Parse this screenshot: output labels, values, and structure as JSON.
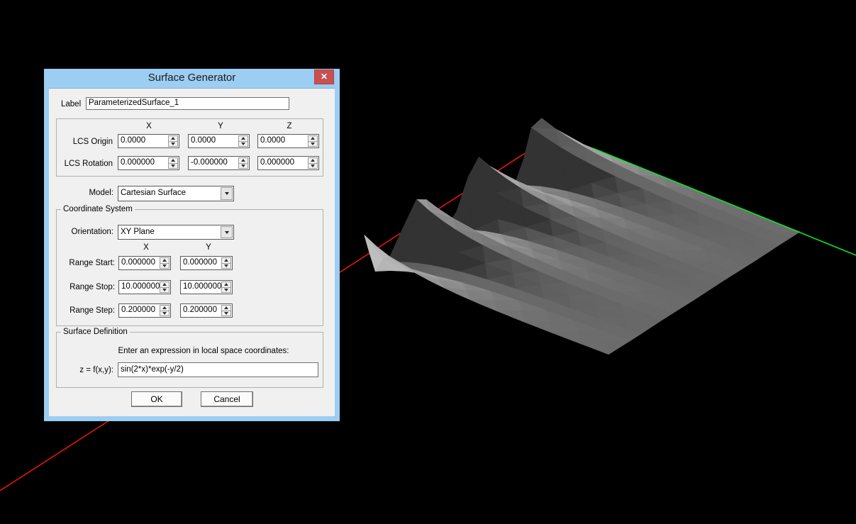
{
  "window": {
    "title": "Surface Generator",
    "close_glyph": "✕"
  },
  "label_row": {
    "caption": "Label",
    "value": "ParameterizedSurface_1"
  },
  "lcs": {
    "headers": [
      "X",
      "Y",
      "Z"
    ],
    "origin_caption": "LCS Origin",
    "origin": [
      "0.0000",
      "0.0000",
      "0.0000"
    ],
    "rotation_caption": "LCS Rotation",
    "rotation": [
      "0.000000",
      "-0.000000",
      "0.000000"
    ]
  },
  "model": {
    "caption": "Model:",
    "value": "Cartesian Surface"
  },
  "coordinate_system": {
    "group_title": "Coordinate System",
    "orientation_caption": "Orientation:",
    "orientation_value": "XY Plane",
    "headers": [
      "X",
      "Y"
    ],
    "rows": [
      {
        "caption": "Range Start:",
        "values": [
          "0.000000",
          "0.000000"
        ]
      },
      {
        "caption": "Range Stop:",
        "values": [
          "10.000000",
          "10.000000"
        ]
      },
      {
        "caption": "Range Step:",
        "values": [
          "0.200000",
          "0.200000"
        ]
      }
    ]
  },
  "surface_definition": {
    "group_title": "Surface Definition",
    "hint": "Enter an expression in local space coordinates:",
    "equation_caption": "z = f(x,y):",
    "expression": "sin(2*x)*exp(-y/2)"
  },
  "buttons": {
    "ok": "OK",
    "cancel": "Cancel"
  },
  "scene": {
    "background": "#000000",
    "x_axis_color": "#e8150a",
    "y_axis_color": "#0ddf2a",
    "surface": {
      "expression": "sin(2*x)*exp(-y/2)",
      "x_range": [
        0,
        10
      ],
      "y_range": [
        0,
        10
      ],
      "flat_color": "#6b6b6b",
      "lit_color": "#b5b5b5",
      "shadow_color": "#333333"
    }
  }
}
